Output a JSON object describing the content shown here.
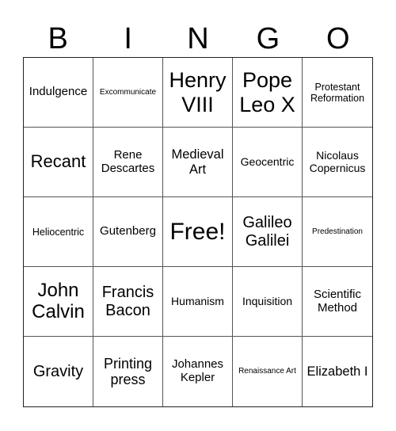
{
  "header": {
    "letters": [
      "B",
      "I",
      "N",
      "G",
      "O"
    ]
  },
  "cells": [
    [
      "Indulgence",
      "Excommunicate",
      "Henry VIII",
      "Pope Leo X",
      "Protestant Reformation"
    ],
    [
      "Recant",
      "Rene Descartes",
      "Medieval Art",
      "Geocentric",
      "Nicolaus Copernicus"
    ],
    [
      "Heliocentric",
      "Gutenberg",
      "Free!",
      "Galileo Galilei",
      "Predestination"
    ],
    [
      "John Calvin",
      "Francis Bacon",
      "Humanism",
      "Inquisition",
      "Scientific Method"
    ],
    [
      "Gravity",
      "Printing press",
      "Johannes Kepler",
      "Renaissance Art",
      "Elizabeth I"
    ]
  ]
}
